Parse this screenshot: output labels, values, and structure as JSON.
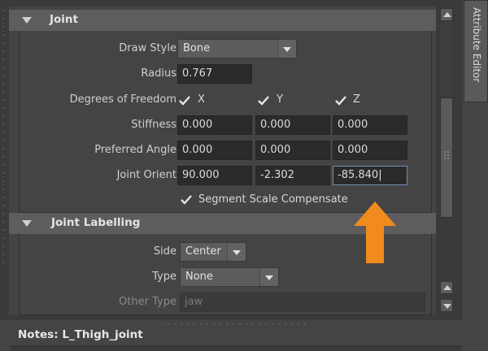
{
  "panel": {
    "side_tab": "Attribute Editor",
    "notes_label": "Notes:  L_Thigh_joint"
  },
  "joint_section": {
    "title": "Joint",
    "draw_style": {
      "label": "Draw Style",
      "value": "Bone"
    },
    "radius": {
      "label": "Radius",
      "value": "0.767"
    },
    "dof": {
      "label": "Degrees of Freedom",
      "x": {
        "label": "X",
        "checked": true
      },
      "y": {
        "label": "Y",
        "checked": true
      },
      "z": {
        "label": "Z",
        "checked": true
      }
    },
    "stiffness": {
      "label": "Stiffness",
      "values": [
        "0.000",
        "0.000",
        "0.000"
      ]
    },
    "preferred_angle": {
      "label": "Preferred Angle",
      "values": [
        "0.000",
        "0.000",
        "0.000"
      ]
    },
    "joint_orient": {
      "label": "Joint Orient",
      "values": [
        "90.000",
        "-2.302",
        "-85.840"
      ]
    },
    "segment_scale": {
      "label": "Segment Scale Compensate",
      "checked": true
    }
  },
  "labelling_section": {
    "title": "Joint Labelling",
    "side": {
      "label": "Side",
      "value": "Center"
    },
    "type": {
      "label": "Type",
      "value": "None"
    },
    "other_type": {
      "label": "Other Type",
      "placeholder": "jaw"
    }
  },
  "annotation": {
    "arrow_color": "#f28b1e"
  },
  "colors": {
    "field_bg": "#2b2b2b",
    "header_bg": "#5d5d5d",
    "panel_bg": "#444444"
  }
}
